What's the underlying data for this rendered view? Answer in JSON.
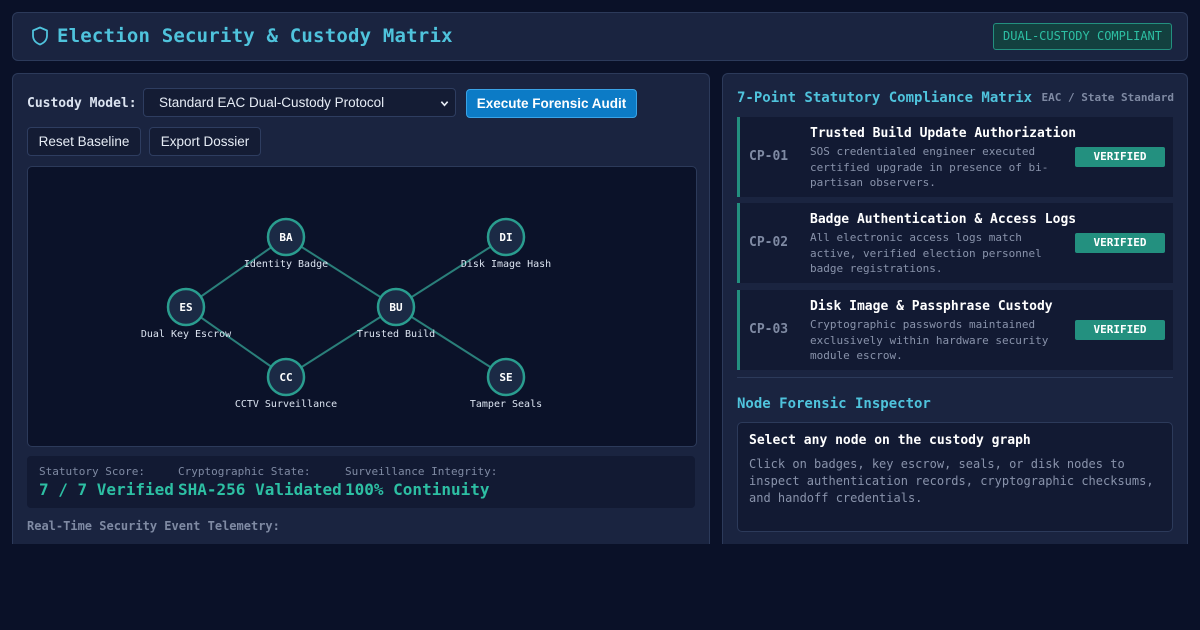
{
  "header": {
    "title": "Election Security & Custody Matrix",
    "badge": "DUAL-CUSTODY COMPLIANT",
    "icon": "shield-icon"
  },
  "controls": {
    "custody_label": "Custody Model:",
    "selected_model": "Standard EAC Dual-Custody Protocol",
    "execute_label": "Execute Forensic Audit",
    "reset_label": "Reset Baseline",
    "export_label": "Export Dossier"
  },
  "graph": {
    "nodes": [
      {
        "id": "BA",
        "label": "Identity Badge"
      },
      {
        "id": "DI",
        "label": "Disk Image Hash"
      },
      {
        "id": "ES",
        "label": "Dual Key Escrow"
      },
      {
        "id": "BU",
        "label": "Trusted Build"
      },
      {
        "id": "CC",
        "label": "CCTV Surveillance"
      },
      {
        "id": "SE",
        "label": "Tamper Seals"
      }
    ],
    "edges": [
      [
        "BA",
        "ES"
      ],
      [
        "BA",
        "BU"
      ],
      [
        "ES",
        "CC"
      ],
      [
        "CC",
        "BU"
      ],
      [
        "BU",
        "DI"
      ],
      [
        "BU",
        "SE"
      ]
    ],
    "colors": {
      "node_fill": "#1b2a45",
      "node_stroke": "#2a9d8f",
      "edge": "#2a7f7a"
    }
  },
  "stats": [
    {
      "label": "Statutory Score:",
      "value": "7 / 7 Verified"
    },
    {
      "label": "Cryptographic State:",
      "value": "SHA-256 Validated"
    },
    {
      "label": "Surveillance Integrity:",
      "value": "100% Continuity"
    }
  ],
  "telemetry_label": "Real-Time Security Event Telemetry:",
  "compliance": {
    "title": "7-Point Statutory Compliance Matrix",
    "standard": "EAC / State Standard",
    "items": [
      {
        "code": "CP-01",
        "title": "Trusted Build Update Authorization",
        "desc": "SOS credentialed engineer executed certified upgrade in presence of bi-partisan observers.",
        "status": "VERIFIED"
      },
      {
        "code": "CP-02",
        "title": "Badge Authentication & Access Logs",
        "desc": "All electronic access logs match active, verified election personnel badge registrations.",
        "status": "VERIFIED"
      },
      {
        "code": "CP-03",
        "title": "Disk Image & Passphrase Custody",
        "desc": "Cryptographic passwords maintained exclusively within hardware security module escrow.",
        "status": "VERIFIED"
      }
    ]
  },
  "inspector": {
    "title": "Node Forensic Inspector",
    "heading": "Select any node on the custody graph",
    "body": "Click on badges, key escrow, seals, or disk nodes to inspect authentication records, cryptographic checksums, and handoff credentials."
  },
  "colors": {
    "accent": "#4fc3dc",
    "success": "#2dbfa3",
    "primary_button": "#0c7bc6",
    "background": "#0a1128"
  }
}
